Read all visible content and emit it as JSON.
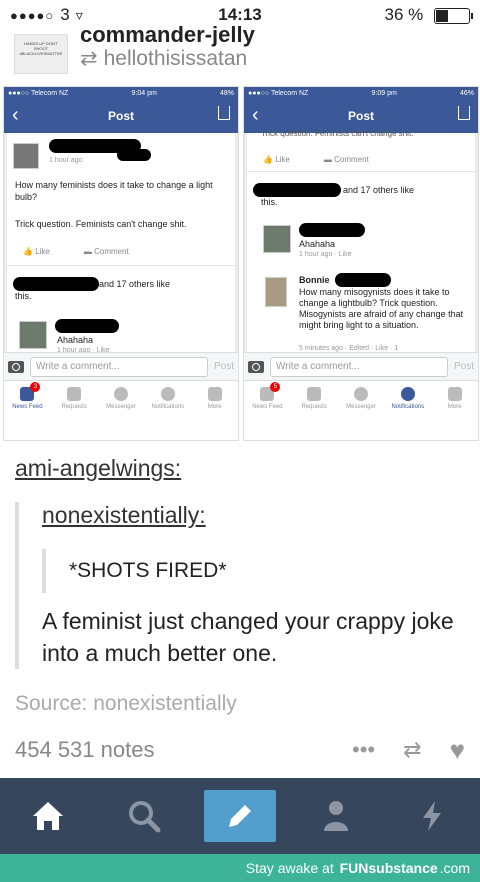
{
  "status_bar": {
    "signal": "●●●●○",
    "carrier": "3",
    "time": "14:13",
    "battery": "36 %"
  },
  "reblog": {
    "avatar_text": "HANDS UP DON'T SHOOT #BLACKLIVESMATTER",
    "blog_name": "commander-jelly",
    "reblogged_from": "hellothisissatan"
  },
  "left_screenshot": {
    "status_left": "●●●○○ Telecom NZ",
    "status_time": "9:04 pm",
    "status_battery": "48%",
    "nav_title": "Post",
    "post_time": "1 hour ago",
    "post_text_1": "How many feminists does it take to change a light bulb?",
    "post_text_2": "Trick question. Feminists can't change shit.",
    "like_label": "Like",
    "comment_label": "Comment",
    "likes_text": "and 17 others like",
    "likes_text_2": "this.",
    "reply_text": "Ahahaha",
    "reply_meta": "1 hour ago · Like",
    "comment_placeholder": "Write a comment...",
    "post_button": "Post",
    "tabs": [
      "News Feed",
      "Requests",
      "Messenger",
      "Notifications",
      "More"
    ],
    "badge": "3"
  },
  "right_screenshot": {
    "status_left": "●●●○○ Telecom NZ",
    "status_time": "9:09 pm",
    "status_battery": "46%",
    "nav_title": "Post",
    "cut_text": "Trick question. Feminists can't change shit.",
    "like_label": "Like",
    "comment_label": "Comment",
    "likes_text": "and 17 others like",
    "likes_text_2": "this.",
    "reply_text": "Ahahaha",
    "reply_meta": "1 hour ago · Like",
    "bonnie_name": "Bonnie",
    "bonnie_text": "How many misogynists does it take to change a lightbulb? Trick question. Misogynists are afraid of any change that might bring light to a situation.",
    "bonnie_meta": "5 minutes ago · Edited · Like · 1",
    "comment_placeholder": "Write a comment...",
    "post_button": "Post",
    "tabs": [
      "News Feed",
      "Requests",
      "Messenger",
      "Notifications",
      "More"
    ],
    "badge": "5"
  },
  "thread": {
    "user_1": "ami-angelwings:",
    "user_2": "nonexistentially:",
    "shots": "*SHOTS FIRED*",
    "body": "A feminist just changed your crappy joke into a much better one."
  },
  "source": "Source: nonexistentially",
  "notes": "454 531 notes",
  "footer": {
    "prefix": "Stay awake at",
    "brand": "FUNsubstance",
    "suffix": ".com"
  }
}
